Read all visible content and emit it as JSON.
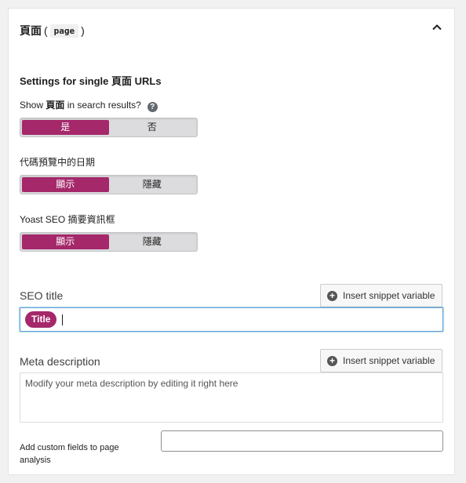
{
  "header": {
    "title": "頁面",
    "paren_open": "(",
    "code": "page",
    "paren_close": ")"
  },
  "section": {
    "heading": "Settings for single 頁面 URLs"
  },
  "search_results": {
    "label_prefix": "Show ",
    "label_bold": "頁面",
    "label_suffix": " in search results?",
    "help": "?",
    "options": [
      "是",
      "否"
    ],
    "selected": "是"
  },
  "date_preview": {
    "label": "代碼預覽中的日期",
    "options": [
      "顯示",
      "隱藏"
    ],
    "selected": "顯示"
  },
  "meta_box": {
    "label": "Yoast SEO 摘要資訊框",
    "options": [
      "顯示",
      "隱藏"
    ],
    "selected": "顯示"
  },
  "seo_title": {
    "label": "SEO title",
    "snippet_button": "Insert snippet variable",
    "pill": "Title"
  },
  "meta_description": {
    "label": "Meta description",
    "snippet_button": "Insert snippet variable",
    "placeholder": "Modify your meta description by editing it right here"
  },
  "custom_fields": {
    "label": "Add custom fields to page analysis",
    "value": ""
  },
  "colors": {
    "accent": "#a4286a",
    "focus_border": "#5b9dd9"
  },
  "icons": {
    "collapse": "chevron-up-icon",
    "help": "question-circle-icon",
    "snippet": "plus-circle-icon"
  }
}
